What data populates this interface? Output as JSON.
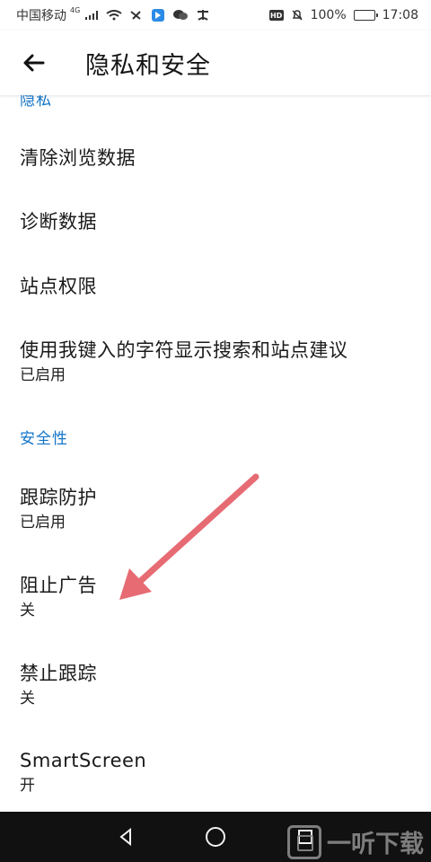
{
  "status_bar": {
    "carrier": "中国移动",
    "network_type": "4G",
    "battery_percent": "100%",
    "time": "17:08"
  },
  "header": {
    "title": "隐私和安全"
  },
  "sections": {
    "privacy": {
      "title": "隐私",
      "items": [
        {
          "title": "清除浏览数据"
        },
        {
          "title": "诊断数据"
        },
        {
          "title": "站点权限"
        },
        {
          "title": "使用我键入的字符显示搜索和站点建议",
          "subtitle": "已启用"
        }
      ]
    },
    "security": {
      "title": "安全性",
      "items": [
        {
          "title": "跟踪防护",
          "subtitle": "已启用"
        },
        {
          "title": "阻止广告",
          "subtitle": "关"
        },
        {
          "title": "禁止跟踪",
          "subtitle": "关"
        },
        {
          "title": "SmartScreen",
          "subtitle": "开"
        }
      ]
    }
  },
  "colors": {
    "section_accent": "#1475c8",
    "annotation_arrow": "#e66b73"
  },
  "watermark": {
    "text": "一听下载"
  }
}
